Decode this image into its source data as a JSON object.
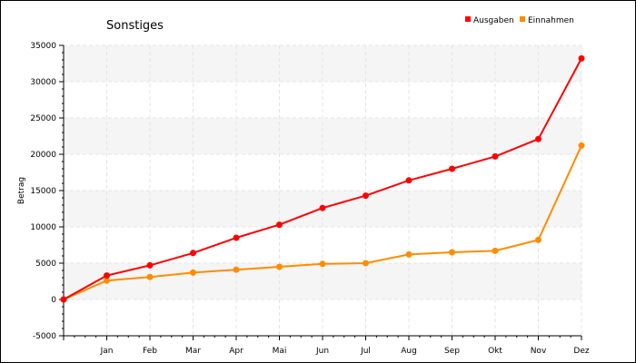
{
  "chart_data": {
    "type": "line",
    "title": "Sonstiges",
    "xlabel": "",
    "ylabel": "Betrag",
    "categories": [
      "",
      "Jan",
      "Feb",
      "Mar",
      "Apr",
      "Mai",
      "Jun",
      "Jul",
      "Aug",
      "Sep",
      "Okt",
      "Nov",
      "Dez"
    ],
    "y_ticks": [
      "-5000",
      "0",
      "5000",
      "10000",
      "15000",
      "20000",
      "25000",
      "30000",
      "35000"
    ],
    "ylim": [
      -5000,
      35000
    ],
    "grid": true,
    "legend": "top-right",
    "series": [
      {
        "name": "Ausgaben",
        "color": "#ff0000",
        "values": [
          0,
          3300,
          4700,
          6400,
          8500,
          10300,
          12600,
          14300,
          16400,
          18000,
          19700,
          22100,
          33200
        ]
      },
      {
        "name": "Einnahmen",
        "color": "#ff8c00",
        "values": [
          0,
          2600,
          3100,
          3700,
          4100,
          4500,
          4900,
          5000,
          6200,
          6500,
          6700,
          8200,
          21200
        ]
      }
    ]
  }
}
